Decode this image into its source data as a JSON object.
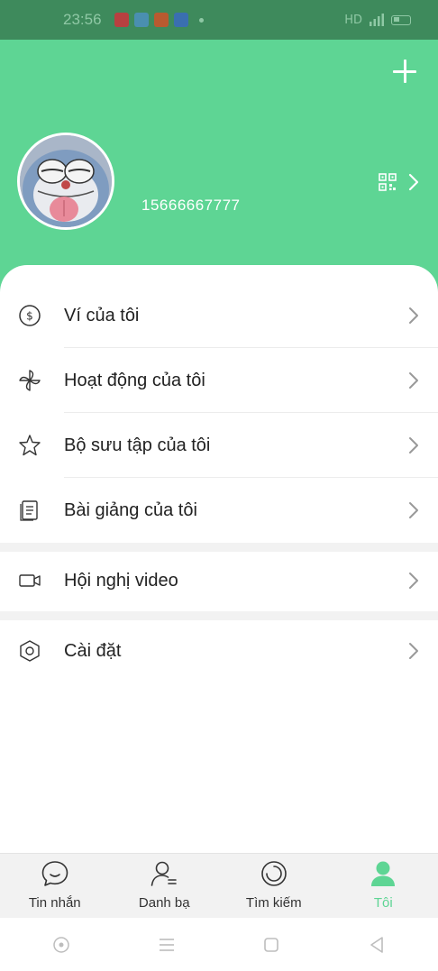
{
  "status_bar": {
    "time": "23:56",
    "network_label": "HD",
    "colors": {
      "background": "#3e8a5c",
      "foreground": "#8fc8a5"
    }
  },
  "header": {
    "background_color": "#5ed594",
    "phone_number": "15666667777",
    "icons": [
      "plus-icon",
      "qr-code-icon",
      "chevron-right-icon"
    ]
  },
  "menu": {
    "items": [
      {
        "label": "Ví của tôi",
        "icon": "wallet-coin-icon"
      },
      {
        "label": "Hoạt động của tôi",
        "icon": "pinwheel-icon"
      },
      {
        "label": "Bộ sưu tập của tôi",
        "icon": "star-icon"
      },
      {
        "label": "Bài giảng của tôi",
        "icon": "document-icon"
      }
    ],
    "video": {
      "label": "Hội nghị video",
      "icon": "video-camera-icon"
    },
    "settings": {
      "label": "Cài đặt",
      "icon": "hexagon-settings-icon"
    }
  },
  "tabbar": {
    "accent_color": "#5ed594",
    "tabs": [
      {
        "label": "Tin nhắn",
        "icon": "chat-bubble-icon",
        "active": false
      },
      {
        "label": "Danh bạ",
        "icon": "contacts-icon",
        "active": false
      },
      {
        "label": "Tìm kiếm",
        "icon": "discover-icon",
        "active": false
      },
      {
        "label": "Tôi",
        "icon": "person-icon",
        "active": true
      }
    ]
  },
  "system_nav": {
    "icons": [
      "assistant-icon",
      "menu-icon",
      "home-icon",
      "back-icon"
    ]
  }
}
